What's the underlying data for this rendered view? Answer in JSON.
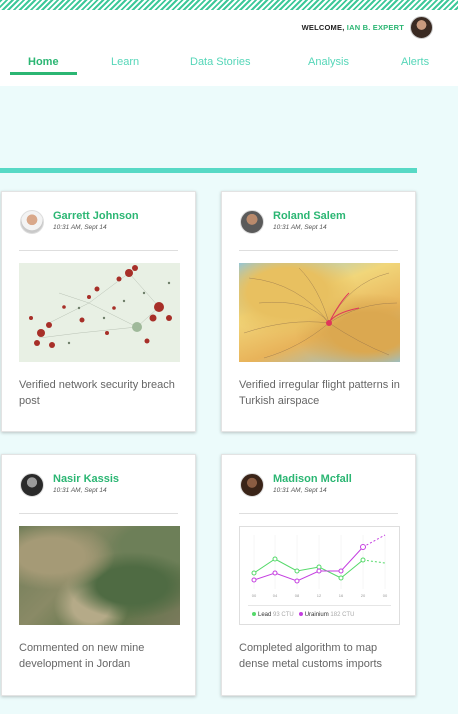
{
  "header": {
    "welcome_prefix": "WELCOME,",
    "user_name": "IAN B. EXPERT"
  },
  "nav": {
    "items": [
      {
        "label": "Home",
        "active": true
      },
      {
        "label": "Learn"
      },
      {
        "label": "Data Stories"
      },
      {
        "label": "Analysis"
      },
      {
        "label": "Alerts"
      }
    ]
  },
  "cards": [
    {
      "name": "Garrett Johnson",
      "time": "10:31 AM, Sept 14",
      "description": "Verified network security breach post",
      "thumbnail": "network-graph"
    },
    {
      "name": "Roland Salem",
      "time": "10:31 AM, Sept 14",
      "description": "Verified irregular flight patterns in Turkish airspace",
      "thumbnail": "flight-map"
    },
    {
      "name": "Nasir Kassis",
      "time": "10:31 AM, Sept 14",
      "description": "Commented on new mine development in Jordan",
      "thumbnail": "satellite-terrain"
    },
    {
      "name": "Madison Mcfall",
      "time": "10:31 AM, Sept 14",
      "description": "Completed algorithm to map dense metal customs imports",
      "thumbnail": "line-chart"
    }
  ],
  "mini_chart": {
    "x_ticks": [
      "00",
      "04",
      "08",
      "12",
      "16",
      "20",
      "00"
    ],
    "legend": [
      {
        "name": "Lead",
        "unit": "93 CTU",
        "color": "#55d96a"
      },
      {
        "name": "Urainium",
        "unit": "182 CTU",
        "color": "#c43ee0"
      }
    ]
  }
}
